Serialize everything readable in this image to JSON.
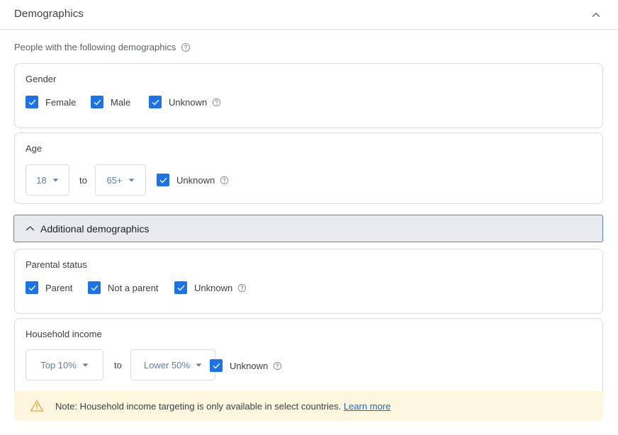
{
  "header": {
    "title": "Demographics",
    "collapse_icon": "chevron-up-icon"
  },
  "subtitle": {
    "text": "People with the following demographics",
    "help_icon": "help-circle-icon"
  },
  "gender": {
    "label": "Gender",
    "options": [
      {
        "label": "Female",
        "checked": true,
        "help": false
      },
      {
        "label": "Male",
        "checked": true,
        "help": false
      },
      {
        "label": "Unknown",
        "checked": true,
        "help": true
      }
    ]
  },
  "age": {
    "label": "Age",
    "from_value": "18",
    "to_separator": "to",
    "to_value": "65+",
    "unknown": {
      "label": "Unknown",
      "checked": true,
      "help": true
    }
  },
  "additional_demographics": {
    "label": "Additional demographics",
    "expanded": true,
    "toggle_icon": "chevron-up-icon"
  },
  "parental_status": {
    "label": "Parental status",
    "options": [
      {
        "label": "Parent",
        "checked": true,
        "help": false
      },
      {
        "label": "Not a parent",
        "checked": true,
        "help": false
      },
      {
        "label": "Unknown",
        "checked": true,
        "help": true
      }
    ]
  },
  "household_income": {
    "label": "Household income",
    "from_value": "Top 10%",
    "to_separator": "to",
    "to_value": "Lower 50%",
    "unknown": {
      "label": "Unknown",
      "checked": true,
      "help": true
    }
  },
  "note": {
    "icon": "warning-triangle-icon",
    "text": "Note: Household income targeting is only available in select countries.",
    "link_label": "Learn more"
  },
  "colors": {
    "accent_blue": "#1a73e8",
    "link_blue": "#1967d2",
    "dropdown_text": "#5b7fa6",
    "card_border": "#dadce0",
    "addl_bar_bg": "#e8eaed",
    "addl_bar_border": "#5a86c5",
    "note_bg": "#fef7e0",
    "warning_amber": "#e8a33d",
    "text_primary": "#3c4043",
    "text_secondary": "#5f6368"
  }
}
